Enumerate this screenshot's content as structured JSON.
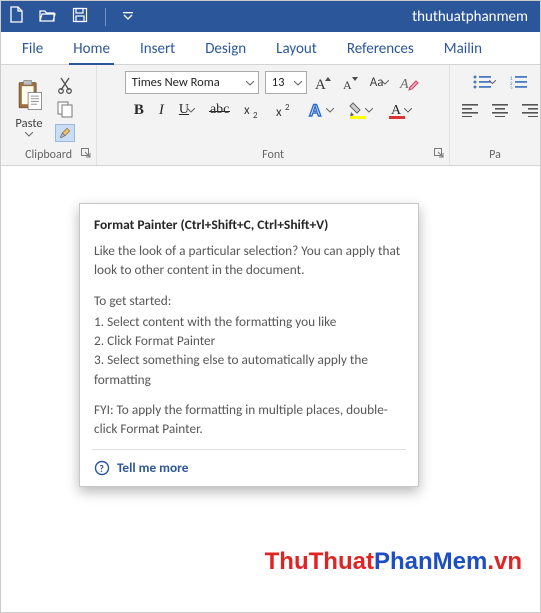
{
  "titlebar": {
    "docname": "thuthuatphanmem"
  },
  "tabs": [
    "File",
    "Home",
    "Insert",
    "Design",
    "Layout",
    "References",
    "Mailin"
  ],
  "active_tab": 1,
  "clipboard": {
    "paste_label": "Paste",
    "group_label": "Clipboard"
  },
  "font": {
    "name_value": "Times New Roma",
    "size_value": "13",
    "group_label": "Font",
    "bold": "B",
    "italic": "I",
    "underline": "U",
    "case_label": "Aa"
  },
  "paragraph": {
    "group_label": "Pa"
  },
  "tooltip": {
    "title": "Format Painter (Ctrl+Shift+C, Ctrl+Shift+V)",
    "p1": "Like the look of a particular selection? You can apply that look to other content in the document.",
    "p2": "To get started:",
    "l1": "1. Select content with the formatting you like",
    "l2": "2. Click Format Painter",
    "l3": "3. Select something else to automatically apply the formatting",
    "p3": "FYI: To apply the formatting in multiple places, double-click Format Painter.",
    "more": "Tell me more"
  },
  "watermark": {
    "a": "ThuThuat",
    "b": "PhanMem",
    "c": ".vn"
  }
}
